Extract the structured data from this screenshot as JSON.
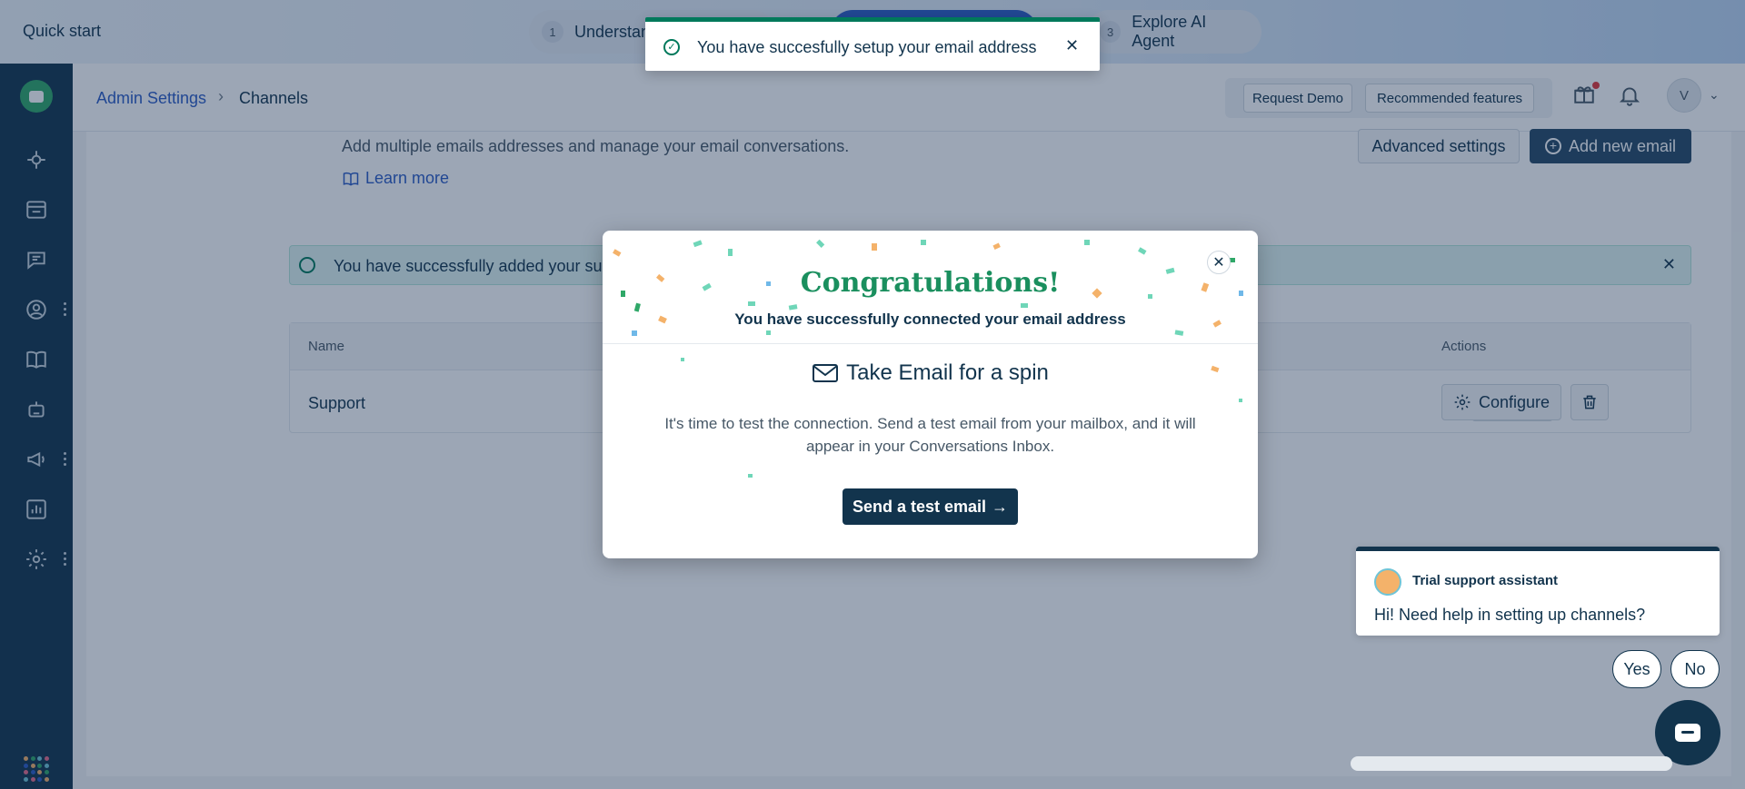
{
  "topbar": {
    "quick_start": "Quick start",
    "steps": [
      {
        "num": "1",
        "label": "Understand"
      },
      {
        "num": "3",
        "label": "Explore AI Agent"
      }
    ]
  },
  "header": {
    "breadcrumb_parent": "Admin Settings",
    "breadcrumb_sep": "›",
    "breadcrumb_current": "Channels",
    "request_demo": "Request Demo",
    "recommended": "Recommended features",
    "avatar_initial": "V"
  },
  "channels": {
    "description": "Add multiple emails addresses and manage your email conversations.",
    "learn_more": "Learn more",
    "advanced_settings": "Advanced settings",
    "add_new_email": "Add new email",
    "alert_text": "You have successfully added your supp",
    "table": {
      "col_name": "Name",
      "col_actions": "Actions",
      "row_name": "Support",
      "configure": "Configure"
    }
  },
  "toast": {
    "text": "You have succesfully setup your email address"
  },
  "modal": {
    "title": "Congratulations!",
    "subtitle": "You have successfully connected your email address",
    "heading": "Take Email for a spin",
    "body": "It's time to test the connection. Send a test email from your mailbox, and it will appear in your Conversations Inbox.",
    "button": "Send a test email",
    "button_arrow": "→"
  },
  "chat": {
    "agent_name": "Trial support assistant",
    "message": "Hi! Need help in setting up channels?",
    "yes": "Yes",
    "no": "No"
  },
  "colors": {
    "sidebar": "#12344d",
    "accent_blue": "#2c5cc5",
    "success_green": "#00795b",
    "congrats_green": "#1a8f5e"
  }
}
